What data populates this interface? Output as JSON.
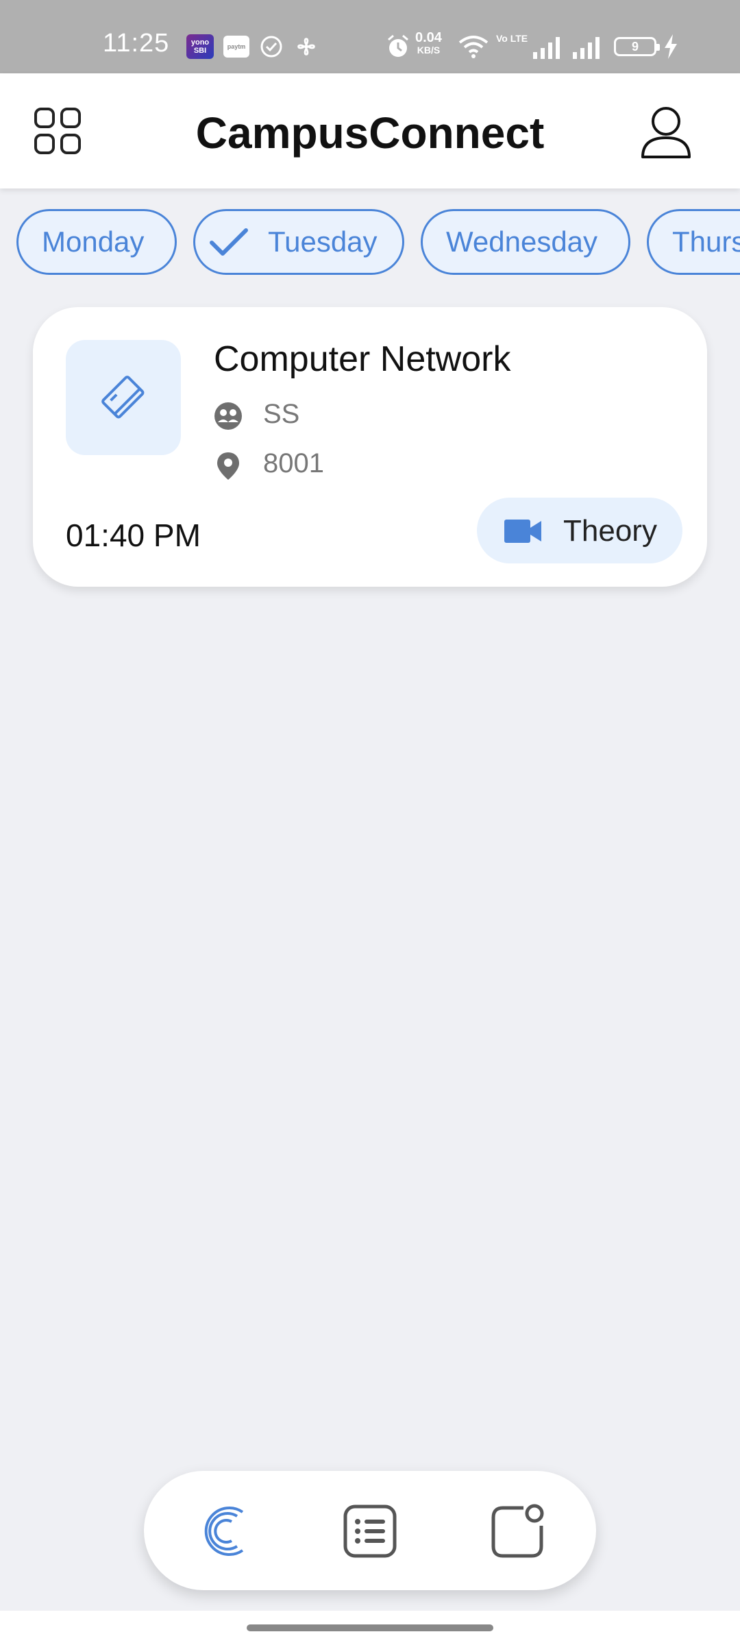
{
  "status_bar": {
    "time": "11:25",
    "yono_label": "yono SBI",
    "paytm_label": "paytm",
    "net_speed": "0.04",
    "net_speed_unit": "KB/S",
    "volte_label": "Vo LTE",
    "battery": "9"
  },
  "app_bar": {
    "title": "CampusConnect",
    "menu_icon": "grid-icon",
    "profile_icon": "person-icon"
  },
  "day_chips": [
    {
      "label": "Monday",
      "selected": false
    },
    {
      "label": "Tuesday",
      "selected": true
    },
    {
      "label": "Wednesday",
      "selected": false
    },
    {
      "label": "Thurs",
      "selected": false
    }
  ],
  "classes": [
    {
      "subject": "Computer Network",
      "faculty": "SS",
      "room": "8001",
      "time": "01:40 PM",
      "type": "Theory",
      "subject_icon": "book-icon",
      "faculty_icon": "faculty-icon",
      "room_icon": "location-pin-icon",
      "type_icon": "video-camera-icon"
    }
  ],
  "bottom_nav": [
    {
      "icon": "campusconnect-logo-icon",
      "active": true
    },
    {
      "icon": "list-icon",
      "active": false
    },
    {
      "icon": "notification-icon",
      "active": false
    }
  ],
  "colors": {
    "accent": "#4a84d8",
    "chip_background": "#eaf2fd",
    "background": "#eff0f4"
  }
}
